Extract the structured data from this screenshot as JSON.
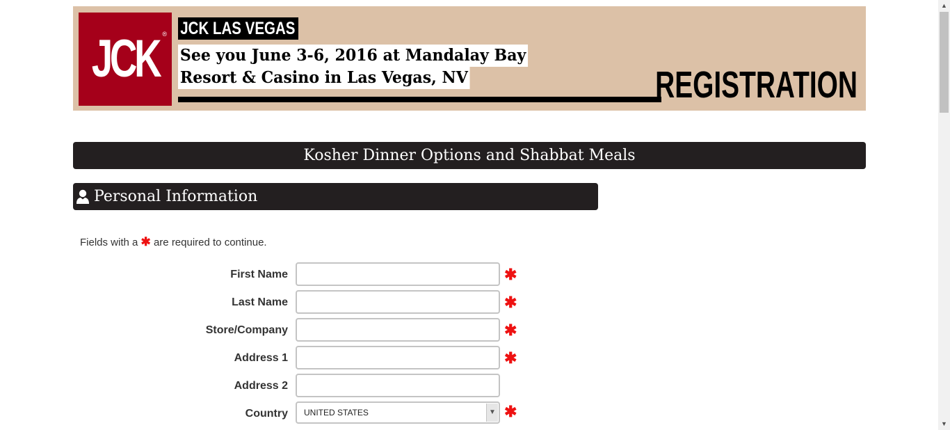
{
  "banner": {
    "logo": "JCK",
    "logo_mark": "®",
    "event_title": "JCK LAS VEGAS",
    "event_line1": "See you June 3-6, 2016 at Mandalay Bay",
    "event_line2": "Resort & Casino in Las Vegas, NV",
    "registration": "REGISTRATION",
    "colors": {
      "background": "#dcc1a7",
      "logo": "#a5001a"
    }
  },
  "section_title": "Kosher Dinner Options and Shabbat Meals",
  "personal": {
    "title": "Personal Information",
    "icon": "user-icon"
  },
  "required_note": {
    "prefix": "Fields with a",
    "star": "✱",
    "suffix": "are required to continue."
  },
  "form": {
    "required_marker": "✱",
    "fields": [
      {
        "label": "First Name",
        "value": "",
        "required": true
      },
      {
        "label": "Last Name",
        "value": "",
        "required": true
      },
      {
        "label": "Store/Company",
        "value": "",
        "required": true
      },
      {
        "label": "Address 1",
        "value": "",
        "required": true
      },
      {
        "label": "Address 2",
        "value": "",
        "required": false
      },
      {
        "label": "Country",
        "value": "UNITED STATES",
        "required": true
      }
    ]
  },
  "colors": {
    "bar": "#231f20",
    "required": "#ee1111"
  }
}
